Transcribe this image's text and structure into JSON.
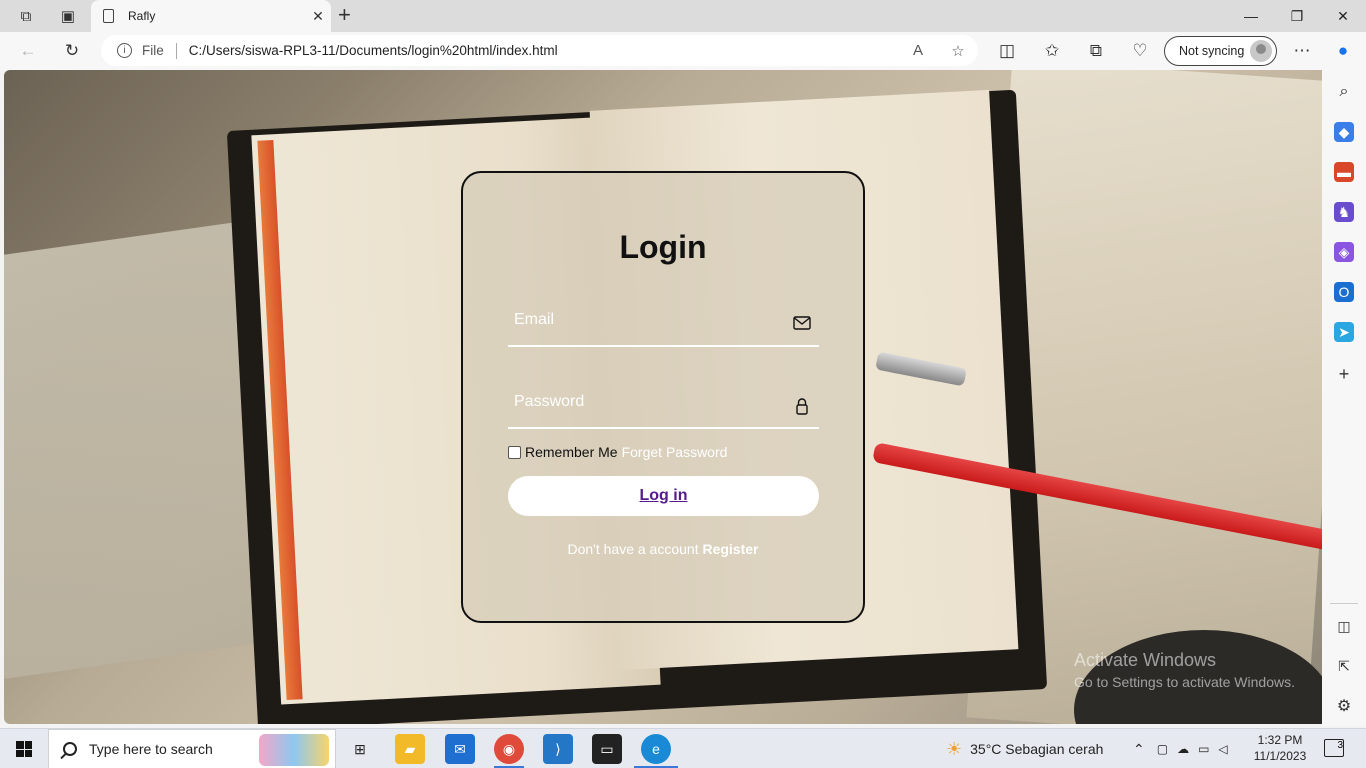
{
  "browser": {
    "tab_title": "Rafly",
    "file_label": "File",
    "url": "C:/Users/siswa-RPL3-11/Documents/login%20html/index.html",
    "profile_label": "Not syncing"
  },
  "login": {
    "title": "Login",
    "email_placeholder": "Email",
    "password_placeholder": "Password",
    "remember_label": "Remember Me",
    "forget_label": "Forget Password",
    "login_button": "Log in",
    "register_prompt": "Don't have a account",
    "register_link": "Register"
  },
  "watermark": {
    "line1": "Activate Windows",
    "line2": "Go to Settings to activate Windows."
  },
  "taskbar": {
    "search_placeholder": "Type here to search",
    "weather": "35°C  Sebagian cerah",
    "time": "1:32 PM",
    "date": "11/1/2023",
    "notification_count": "3"
  },
  "colors": {
    "card_border": "#111111",
    "link_visited": "#551a8b",
    "edge_accent": "#0c59a4"
  }
}
